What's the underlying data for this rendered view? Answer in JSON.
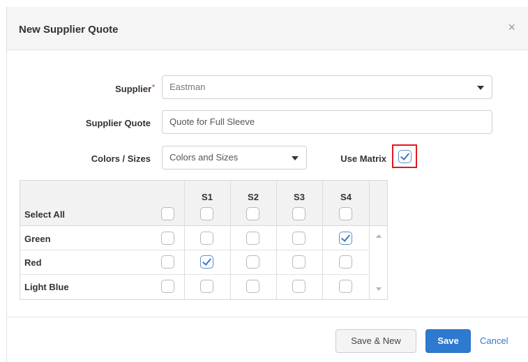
{
  "dialog": {
    "title": "New Supplier Quote",
    "close_glyph": "×"
  },
  "form": {
    "supplier": {
      "label": "Supplier",
      "required_mark": "*",
      "value": "Eastman"
    },
    "supplier_quote": {
      "label": "Supplier Quote",
      "value": "Quote for Full Sleeve"
    },
    "colors_sizes": {
      "label": "Colors / Sizes",
      "value": "Colors and Sizes"
    },
    "use_matrix": {
      "label": "Use Matrix",
      "checked": true
    }
  },
  "matrix": {
    "select_all_label": "Select All",
    "columns": [
      "S1",
      "S2",
      "S3",
      "S4"
    ],
    "rows": [
      {
        "name": "Green",
        "row_checked": false,
        "cells": [
          false,
          false,
          false,
          true
        ]
      },
      {
        "name": "Red",
        "row_checked": false,
        "cells": [
          true,
          false,
          false,
          false
        ]
      },
      {
        "name": "Light Blue",
        "row_checked": false,
        "cells": [
          false,
          false,
          false,
          false
        ]
      }
    ]
  },
  "footer": {
    "save_new_label": "Save & New",
    "save_label": "Save",
    "cancel_label": "Cancel"
  },
  "colors": {
    "primary": "#2d7ad0",
    "highlight": "#e1191f",
    "required": "#d9534f"
  },
  "icons": {
    "close": "close-icon",
    "dropdown": "caret-down-icon",
    "scroll_up": "scroll-up-arrow-icon",
    "scroll_down": "scroll-down-arrow-icon"
  }
}
